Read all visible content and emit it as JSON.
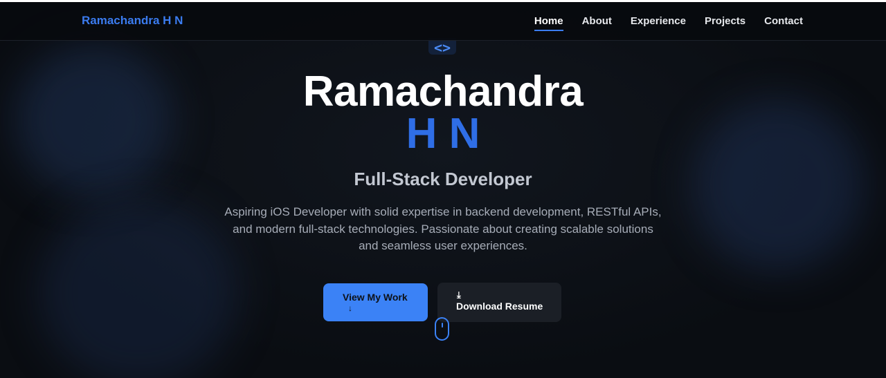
{
  "navbar": {
    "brand": "Ramachandra H N",
    "links": [
      {
        "label": "Home",
        "active": true
      },
      {
        "label": "About",
        "active": false
      },
      {
        "label": "Experience",
        "active": false
      },
      {
        "label": "Projects",
        "active": false
      },
      {
        "label": "Contact",
        "active": false
      }
    ]
  },
  "hero": {
    "code_icon": "<>",
    "name_line1": "Ramachandra",
    "name_line2": "H N",
    "role": "Full-Stack Developer",
    "description": "Aspiring iOS Developer with solid expertise in backend development, RESTful APIs, and modern full-stack technologies. Passionate about creating scalable solutions and seamless user experiences.",
    "primary_button": {
      "label": "View My Work",
      "icon": "arrow-down-icon",
      "glyph": "↓"
    },
    "secondary_button": {
      "label": "Download Resume",
      "icon": "download-icon",
      "glyph": "⤓"
    }
  },
  "colors": {
    "accent": "#3b82f6",
    "name_accent": "#2f6ee6",
    "background": "#0b0e13"
  },
  "scroll_indicator": {
    "icon": "mouse-scroll-icon"
  }
}
